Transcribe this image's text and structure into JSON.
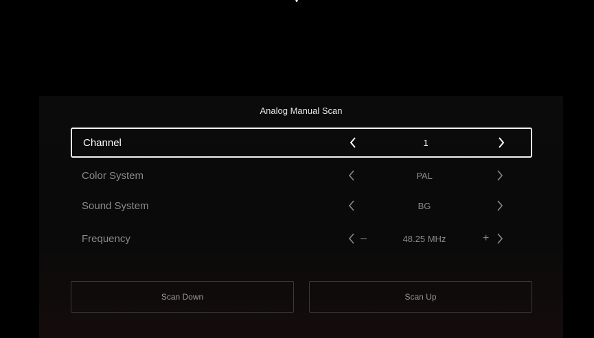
{
  "title": "Analog Manual Scan",
  "rows": [
    {
      "label": "Channel",
      "value": "1",
      "focused": true
    },
    {
      "label": "Color System",
      "value": "PAL",
      "focused": false
    },
    {
      "label": "Sound System",
      "value": "BG",
      "focused": false
    },
    {
      "label": "Frequency",
      "value": "48.25 MHz",
      "focused": false,
      "minus": "–",
      "plus": "+"
    }
  ],
  "buttons": {
    "scan_down": "Scan Down",
    "scan_up": "Scan Up"
  },
  "icons": {
    "left": "chevron-left-icon",
    "right": "chevron-right-icon"
  },
  "colors": {
    "background": "#000000",
    "focused_border": "#f2f2f2",
    "dim_text": "#8a8a8a"
  }
}
